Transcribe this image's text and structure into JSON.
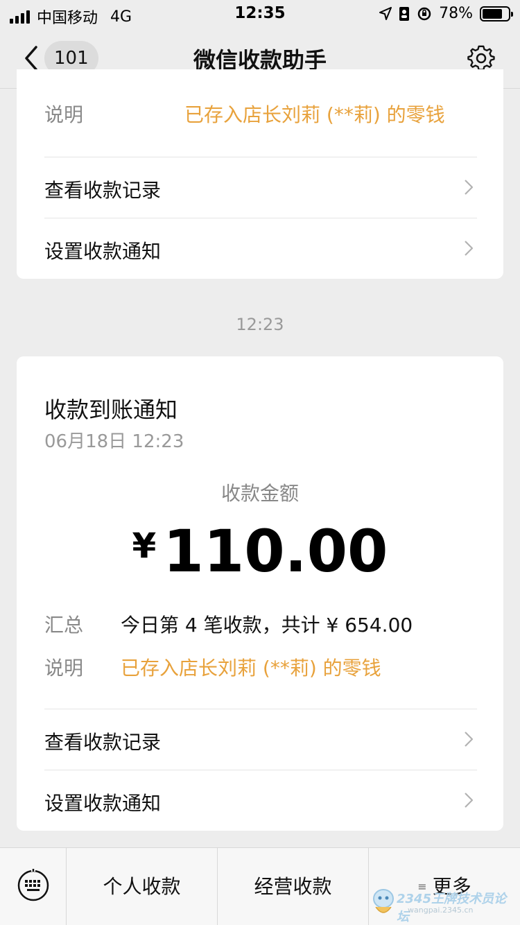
{
  "status_bar": {
    "carrier": "中国移动",
    "network": "4G",
    "time": "12:35",
    "battery_percent": "78%",
    "battery_level": 0.78
  },
  "nav": {
    "unread_count": "101",
    "title": "微信收款助手"
  },
  "card_top": {
    "note_label": "说明",
    "note_value": "已存入店长刘莉 (**莉) 的零钱",
    "rows": [
      {
        "label": "查看收款记录"
      },
      {
        "label": "设置收款通知"
      }
    ]
  },
  "time_separator": "12:23",
  "notice": {
    "title": "收款到账通知",
    "date": "06月18日 12:23",
    "amount_label": "收款金额",
    "currency": "¥",
    "amount": "110.00",
    "summary_label": "汇总",
    "summary_value": "今日第 4 笔收款，共计 ¥ 654.00",
    "note_label": "说明",
    "note_value": "已存入店长刘莉 (**莉) 的零钱",
    "rows": [
      {
        "label": "查看收款记录"
      },
      {
        "label": "设置收款通知"
      }
    ]
  },
  "bottom_menu": {
    "items": [
      {
        "label": "个人收款"
      },
      {
        "label": "经营收款"
      },
      {
        "label": "更多"
      }
    ]
  },
  "watermark": {
    "text": "2345王牌技术员论坛",
    "url": "wangpai.2345.cn"
  },
  "colors": {
    "accent_orange": "#e8a23c",
    "background": "#ededed"
  }
}
